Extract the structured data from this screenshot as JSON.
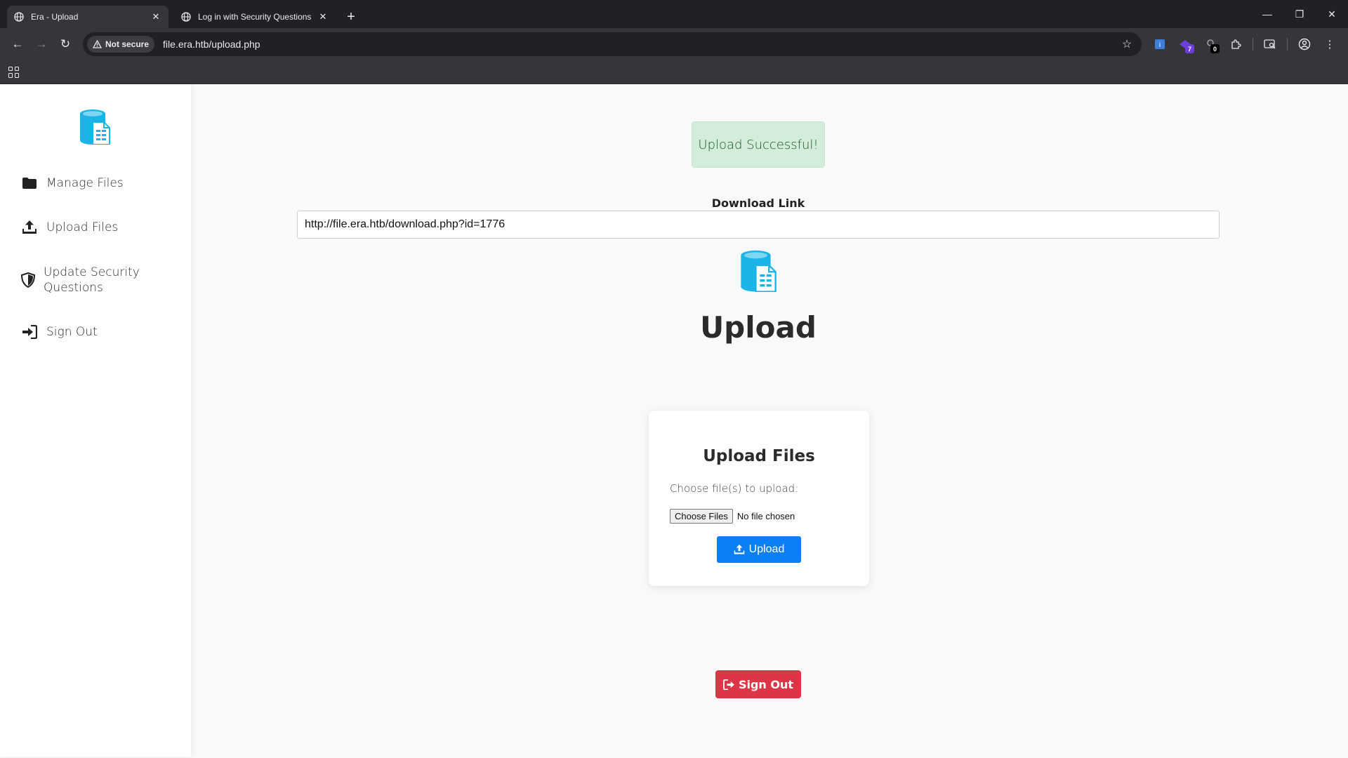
{
  "browser": {
    "tabs": [
      {
        "title": "Era - Upload",
        "active": true
      },
      {
        "title": "Log in with Security Questions",
        "active": false
      }
    ],
    "new_tab": "+",
    "security_chip": "Not secure",
    "url": "file.era.htb/upload.php",
    "extensions": [
      {
        "icon": "extension-a-icon",
        "badge": ""
      },
      {
        "icon": "extension-b-icon",
        "badge": "7"
      },
      {
        "icon": "extension-c-icon",
        "badge": "0"
      }
    ]
  },
  "sidebar": {
    "items": [
      {
        "label": "Manage Files",
        "icon": "folder-icon"
      },
      {
        "label": "Upload Files",
        "icon": "upload-icon"
      },
      {
        "label": "Update Security Questions",
        "icon": "shield-icon"
      },
      {
        "label": "Sign Out",
        "icon": "sign-in-icon"
      }
    ]
  },
  "main": {
    "alert": "Upload Successful!",
    "download_label": "Download Link",
    "download_url": "http://file.era.htb/download.php?id=1776",
    "heading": "Upload",
    "card": {
      "title": "Upload Files",
      "choose_label": "Choose file(s) to upload:",
      "choose_button": "Choose Files",
      "no_file": "No file chosen",
      "upload_button": "Upload"
    },
    "signout_button": "Sign Out"
  },
  "colors": {
    "accent_blue": "#0d7ff4",
    "danger_red": "#dc3545",
    "success_bg": "#d4edda",
    "success_text": "#155724",
    "logo_cyan": "#1ab4e6"
  }
}
